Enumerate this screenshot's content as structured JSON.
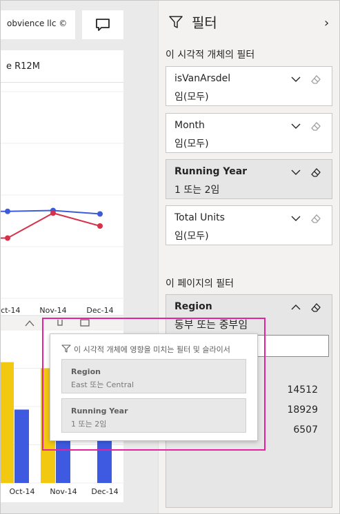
{
  "canvas": {
    "brand_label": "obvience llc ©",
    "line_visual_title": "e R12M"
  },
  "chart_data": [
    {
      "type": "line",
      "categories": [
        "Oct-14",
        "Nov-14",
        "Dec-14"
      ],
      "series": [
        {
          "color": "#3b5bdb",
          "values": [
            101,
            102,
            98
          ]
        },
        {
          "color": "#d7314a",
          "values": [
            70,
            99,
            84
          ]
        }
      ],
      "ylim": [
        0,
        240
      ],
      "grid": true,
      "partially_visible": true
    },
    {
      "type": "bar",
      "categories": [
        "Oct-14",
        "Nov-14",
        "Dec-14"
      ],
      "series": [
        {
          "color": "#f2c811",
          "values": [
            158,
            150,
            0
          ]
        },
        {
          "color": "#3d5ae0",
          "values": [
            96,
            100,
            100
          ]
        }
      ],
      "ylim": [
        0,
        200
      ],
      "grid": true,
      "partially_visible": true
    }
  ],
  "pane": {
    "title": "필터",
    "visual_section_title": "이 시각적 개체의 필터",
    "page_section_title": "이 페이지의 필터",
    "visual_filters": [
      {
        "name": "isVanArsdel",
        "value": "임(모두)",
        "selected": false
      },
      {
        "name": "Month",
        "value": "임(모두)",
        "selected": false
      },
      {
        "name": "Running Year",
        "value": "1 또는 2임",
        "selected": true
      },
      {
        "name": "Total Units",
        "value": "임(모두)",
        "selected": false
      }
    ],
    "page_filter": {
      "name": "Region",
      "value": "동부 또는 중부임",
      "numbers": [
        "14512",
        "18929",
        "6507"
      ]
    }
  },
  "popup": {
    "title": "이 시각적 개체에 영향을 미치는 필터 및 슬라이서",
    "items": [
      {
        "name": "Region",
        "value": "East 또는 Central"
      },
      {
        "name": "Running Year",
        "value": "1 또는 2임"
      }
    ]
  },
  "colors": {
    "accent_highlight": "#e6219d",
    "series_blue": "#3d5ae0",
    "series_red": "#d7314a",
    "series_yellow": "#f2c811"
  }
}
